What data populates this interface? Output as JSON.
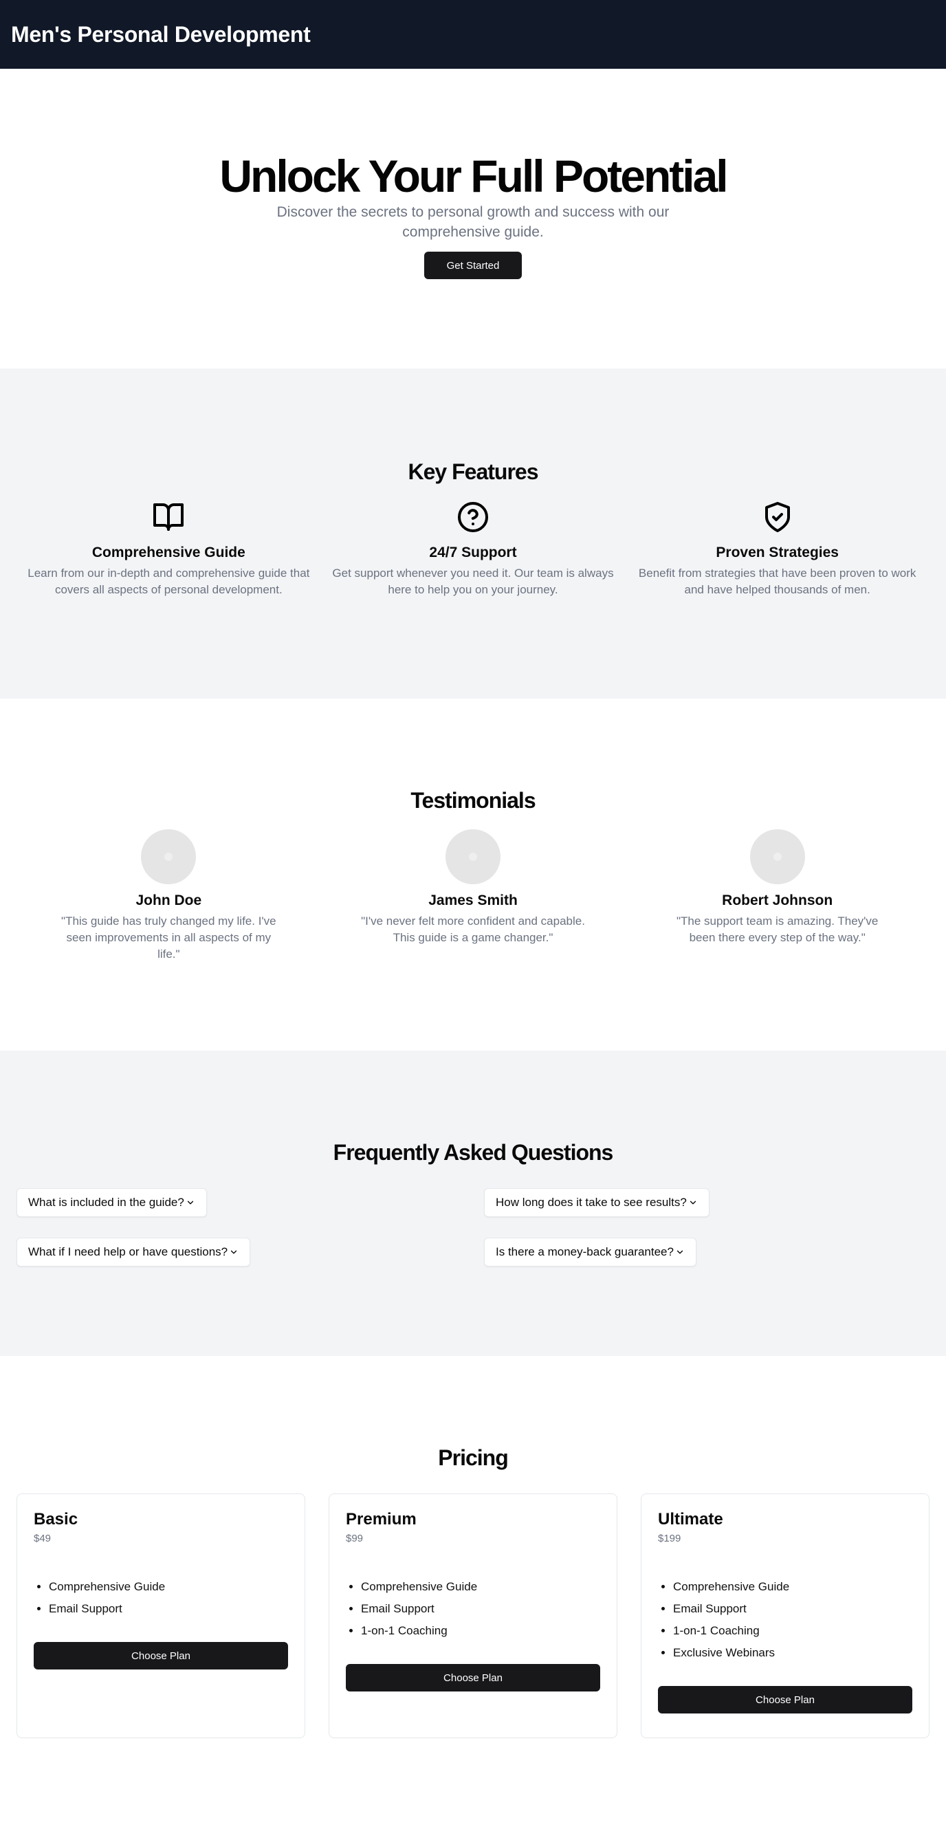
{
  "header": {
    "title": "Men's Personal Development"
  },
  "hero": {
    "title": "Unlock Your Full Potential",
    "subtitle": "Discover the secrets to personal growth and success with our comprehensive guide.",
    "cta": "Get Started"
  },
  "features": {
    "title": "Key Features",
    "items": [
      {
        "icon": "book-open-icon",
        "title": "Comprehensive Guide",
        "text": "Learn from our in-depth and comprehensive guide that covers all aspects of personal development."
      },
      {
        "icon": "help-circle-icon",
        "title": "24/7 Support",
        "text": "Get support whenever you need it. Our team is always here to help you on your journey."
      },
      {
        "icon": "shield-check-icon",
        "title": "Proven Strategies",
        "text": "Benefit from strategies that have been proven to work and have helped thousands of men."
      }
    ]
  },
  "testimonials": {
    "title": "Testimonials",
    "items": [
      {
        "name": "John Doe",
        "quote": "\"This guide has truly changed my life. I've seen improvements in all aspects of my life.\""
      },
      {
        "name": "James Smith",
        "quote": "\"I've never felt more confident and capable. This guide is a game changer.\""
      },
      {
        "name": "Robert Johnson",
        "quote": "\"The support team is amazing. They've been there every step of the way.\""
      }
    ]
  },
  "faq": {
    "title": "Frequently Asked Questions",
    "questions": [
      "What is included in the guide?",
      "How long does it take to see results?",
      "What if I need help or have questions?",
      "Is there a money-back guarantee?"
    ]
  },
  "pricing": {
    "title": "Pricing",
    "plans": [
      {
        "name": "Basic",
        "price": "$49",
        "features": [
          "Comprehensive Guide",
          "Email Support"
        ],
        "cta": "Choose Plan"
      },
      {
        "name": "Premium",
        "price": "$99",
        "features": [
          "Comprehensive Guide",
          "Email Support",
          "1-on-1 Coaching"
        ],
        "cta": "Choose Plan"
      },
      {
        "name": "Ultimate",
        "price": "$199",
        "features": [
          "Comprehensive Guide",
          "Email Support",
          "1-on-1 Coaching",
          "Exclusive Webinars"
        ],
        "cta": "Choose Plan"
      }
    ]
  },
  "colors": {
    "header_bg": "#111827",
    "section_gray": "#f3f4f6",
    "button_dark": "#18181b",
    "muted_text": "#6b7280"
  }
}
